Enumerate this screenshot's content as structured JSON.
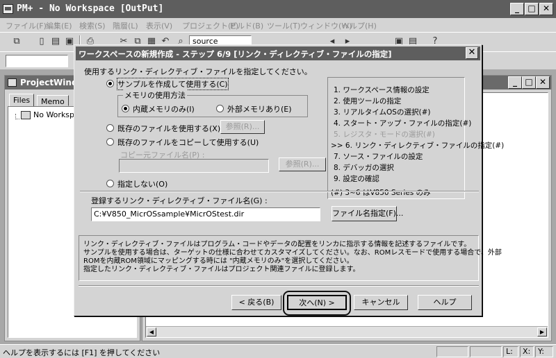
{
  "app": {
    "title": "PM+ - No Workspace [OutPut]"
  },
  "menu": {
    "items": [
      "ファイル(F)",
      "編集(E)",
      "検索(S)",
      "階層(L)",
      "表示(V)",
      "プロジェクト(P)",
      "ビルド(B)",
      "ツール(T)",
      "ウィンドウ(W)",
      "ヘルプ(H)"
    ]
  },
  "toolbar": {
    "combo_value": "source"
  },
  "project_window": {
    "title": "ProjectWindow",
    "tabs": [
      "Files",
      "Memo"
    ],
    "tree_item": "No Workspace"
  },
  "dialog": {
    "title": "ワークスペースの新規作成 - ステップ 6/9 [リンク・ディレクティブ・ファイルの指定]",
    "instruction": "使用するリンク・ディレクティブ・ファイルを指定してください。",
    "opt_sample": "サンプルを作成して使用する(C)",
    "memory_group_label": "メモリの使用方法",
    "opt_internal": "内蔵メモリのみ(I)",
    "opt_external": "外部メモリあり(E)",
    "opt_existing": "既存のファイルを使用する(X)",
    "browse1": "参照(R)...",
    "opt_copy": "既存のファイルをコピーして使用する(U)",
    "copy_source_label": "コピー元ファイル名(P) :",
    "browse2": "参照(R)...",
    "opt_none": "指定しない(O)",
    "register_label": "登録するリンク・ディレクティブ・ファイル名(G) :",
    "register_value": "C:¥V850_MicrOSsample¥MicrOStest.dir",
    "filename_button": "ファイル名指定(F)...",
    "steps": [
      "1. ワークスペース情報の設定",
      "2. 使用ツールの指定",
      "3. リアルタイムOSの選択(#)",
      "4. スタート・アップ・ファイルの指定(#)",
      "5. レジスタ・モードの選択(#)",
      ">> 6. リンク・ディレクティブ・ファイルの指定(#)",
      "7. ソース・ファイルの設定",
      "8. デバッガの選択",
      "9. 設定の確認"
    ],
    "steps_note": "(#) 3~6 はV850 Series のみ",
    "description": [
      "リンク・ディレクティブ・ファイルはプログラム・コードやデータの配置をリンカに指示する情報を記述するファイルです。",
      "サンプルを使用する場合は、ターゲットの仕様に合わせてカスタマイズしてください。なお、ROMレスモードで使用する場合で、外部",
      "ROMを内蔵ROM領域にマッピングする時には \"内蔵メモリのみ\"を選択してください。",
      "指定したリンク・ディレクティブ・ファイルはプロジェクト関連ファイルに登録します。"
    ],
    "back": "< 戻る(B)",
    "next": "次へ(N) >",
    "cancel": "キャンセル",
    "help": "ヘルプ"
  },
  "status": {
    "text": "ヘルプを表示するには [F1] を押してください",
    "line": "L:",
    "x": "X:",
    "y": "Y:"
  }
}
